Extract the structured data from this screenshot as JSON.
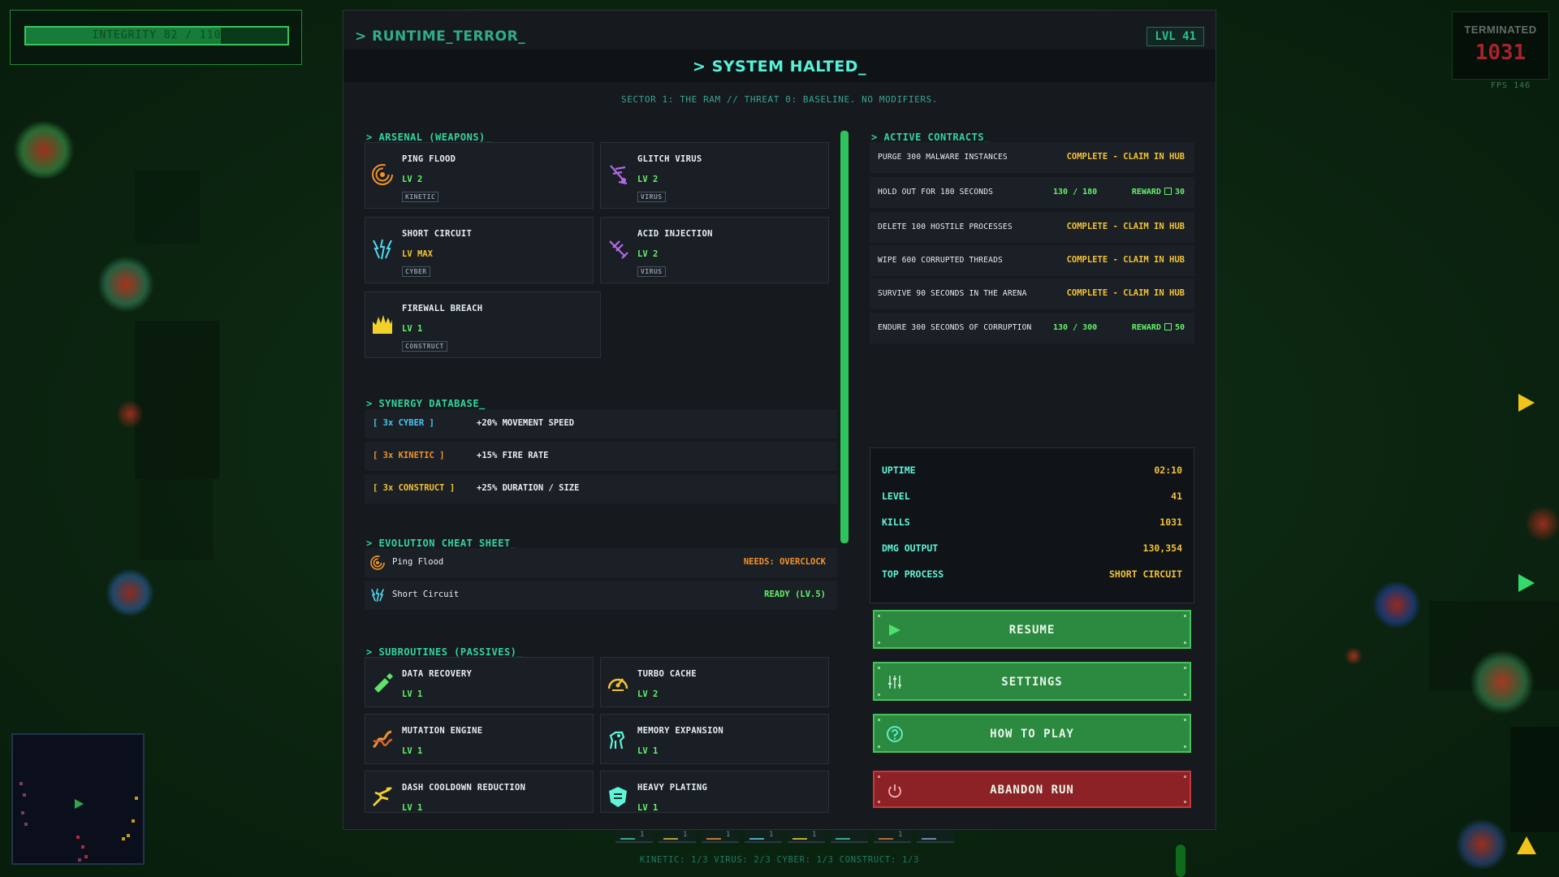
{
  "hud": {
    "integrity_text": "INTEGRITY 82 / 110",
    "integrity_fraction": 0.745,
    "kills_label": "TERMINATED",
    "kills_value": "1031",
    "fps": "FPS 146"
  },
  "header": {
    "brand": "> RUNTIME_TERROR_",
    "level_badge": "LVL 41",
    "title": "> SYSTEM HALTED_",
    "subtitle": "SECTOR 1: THE RAM // THREAT 0: BASELINE. NO MODIFIERS."
  },
  "arsenal": {
    "heading": "> ARSENAL (WEAPONS)_",
    "weapons": [
      {
        "name": "PING FLOOD",
        "level": "LV 2",
        "tag": "KINETIC",
        "icon": "ping-flood-icon"
      },
      {
        "name": "GLITCH VIRUS",
        "level": "LV 2",
        "tag": "VIRUS",
        "icon": "glitch-virus-icon"
      },
      {
        "name": "SHORT CIRCUIT",
        "level": "LV MAX",
        "tag": "CYBER",
        "icon": "short-circuit-icon"
      },
      {
        "name": "ACID INJECTION",
        "level": "LV 2",
        "tag": "VIRUS",
        "icon": "acid-injection-icon"
      },
      {
        "name": "FIREWALL BREACH",
        "level": "LV 1",
        "tag": "CONSTRUCT",
        "icon": "firewall-breach-icon"
      }
    ]
  },
  "synergy": {
    "heading": "> SYNERGY DATABASE_",
    "rows": [
      {
        "tag": "[ 3x CYBER ]",
        "bonus": "+20% MOVEMENT SPEED",
        "color": "#44c9f0"
      },
      {
        "tag": "[ 3x KINETIC ]",
        "bonus": "+15% FIRE RATE",
        "color": "#f2922a"
      },
      {
        "tag": "[ 3x CONSTRUCT ]",
        "bonus": "+25% DURATION / SIZE",
        "color": "#f2c232"
      }
    ]
  },
  "evolution": {
    "heading": "> EVOLUTION CHEAT SHEET_",
    "rows": [
      {
        "name": "Ping Flood",
        "status": "NEEDS: OVERCLOCK",
        "color": "#f2922a",
        "icon": "ping-flood-icon"
      },
      {
        "name": "Short Circuit",
        "status": "READY (LV.5)",
        "color": "#64f06a",
        "icon": "short-circuit-icon"
      }
    ]
  },
  "passives": {
    "heading": "> SUBROUTINES (PASSIVES)_",
    "items": [
      {
        "name": "DATA RECOVERY",
        "level": "LV 1",
        "icon": "data-recovery-icon"
      },
      {
        "name": "TURBO CACHE",
        "level": "LV 2",
        "icon": "turbo-cache-icon"
      },
      {
        "name": "MUTATION ENGINE",
        "level": "LV 1",
        "icon": "mutation-engine-icon"
      },
      {
        "name": "MEMORY EXPANSION",
        "level": "LV 1",
        "icon": "memory-expansion-icon"
      },
      {
        "name": "DASH COOLDOWN REDUCTION",
        "level": "LV 1",
        "icon": "dash-cooldown-icon"
      },
      {
        "name": "HEAVY PLATING",
        "level": "LV 1",
        "icon": "heavy-plating-icon"
      }
    ]
  },
  "contracts": {
    "heading": "> ACTIVE CONTRACTS_",
    "items": [
      {
        "name": "PURGE 300 MALWARE INSTANCES",
        "status": "COMPLETE - CLAIM IN HUB"
      },
      {
        "name": "HOLD OUT FOR 180 SECONDS",
        "progress": "130 / 180",
        "reward_label": "REWARD",
        "reward_value": "30"
      },
      {
        "name": "DELETE 100 HOSTILE PROCESSES",
        "status": "COMPLETE - CLAIM IN HUB"
      },
      {
        "name": "WIPE 600 CORRUPTED THREADS",
        "status": "COMPLETE - CLAIM IN HUB"
      },
      {
        "name": "SURVIVE 90 SECONDS IN THE ARENA",
        "status": "COMPLETE - CLAIM IN HUB"
      },
      {
        "name": "ENDURE 300 SECONDS OF CORRUPTION",
        "progress": "130 / 300",
        "reward_label": "REWARD",
        "reward_value": "50"
      }
    ]
  },
  "stats": [
    {
      "label": "UPTIME",
      "value": "02:10"
    },
    {
      "label": "LEVEL",
      "value": "41"
    },
    {
      "label": "KILLS",
      "value": "1031"
    },
    {
      "label": "DMG OUTPUT",
      "value": "130,354"
    },
    {
      "label": "TOP PROCESS",
      "value": "SHORT CIRCUIT"
    }
  ],
  "buttons": {
    "resume": "RESUME",
    "settings": "SETTINGS",
    "how_to_play": "HOW TO PLAY",
    "abandon": "ABANDON RUN"
  },
  "hotbar": [
    "1",
    "1",
    "1",
    "1",
    "1",
    "",
    "1",
    ""
  ],
  "bottom_status": "KINETIC: 1/3   VIRUS: 2/3   CYBER: 1/3   CONSTRUCT: 1/3"
}
